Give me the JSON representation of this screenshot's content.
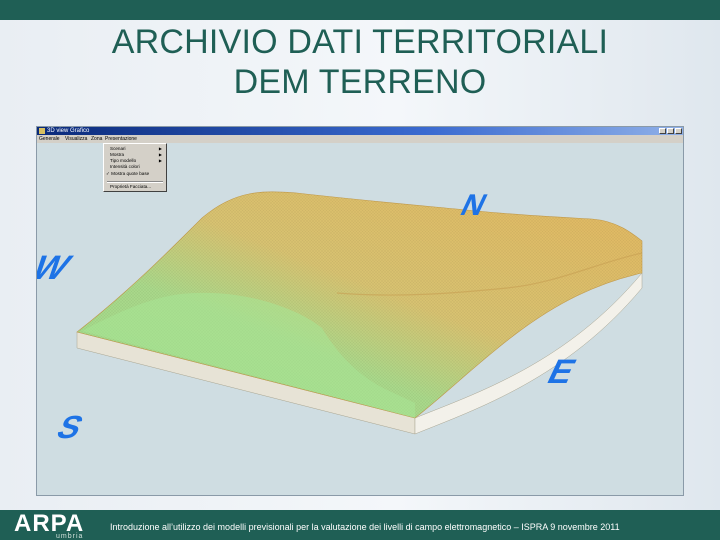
{
  "slide": {
    "title_line1": "ARCHIVIO DATI TERRITORIALI",
    "title_line2": "DEM TERRENO"
  },
  "window": {
    "app_title": "3D  view  Grafico",
    "menu": [
      "Generale",
      "Visualizza",
      "Zona",
      "Presentazione"
    ],
    "dropdown_items": [
      {
        "label": "Scenari",
        "submenu": true
      },
      {
        "label": "Mostra",
        "submenu": true
      },
      {
        "label": "Tipo modello",
        "submenu": true
      },
      {
        "label": "Intensità colori",
        "submenu": false
      },
      {
        "label": "✓ Mostra quote base",
        "submenu": false
      },
      {
        "label": "Proprietà Facciata...",
        "submenu": false
      }
    ]
  },
  "compass": {
    "north": "N",
    "south": "S",
    "east": "E",
    "west": "W",
    "color": "#1e73e6"
  },
  "colors": {
    "header_bar": "#1f5f55",
    "title": "#1f5f55",
    "terrain_high": "#e2b760",
    "terrain_low": "#9fdc8c",
    "base_side": "#f3f1ea"
  },
  "footer": {
    "logo_text": "ARPA",
    "logo_sub": "umbria",
    "text": "Introduzione all’utilizzo dei modelli previsionali per la valutazione dei livelli di campo elettromagnetico – ISPRA 9 novembre 2011"
  }
}
